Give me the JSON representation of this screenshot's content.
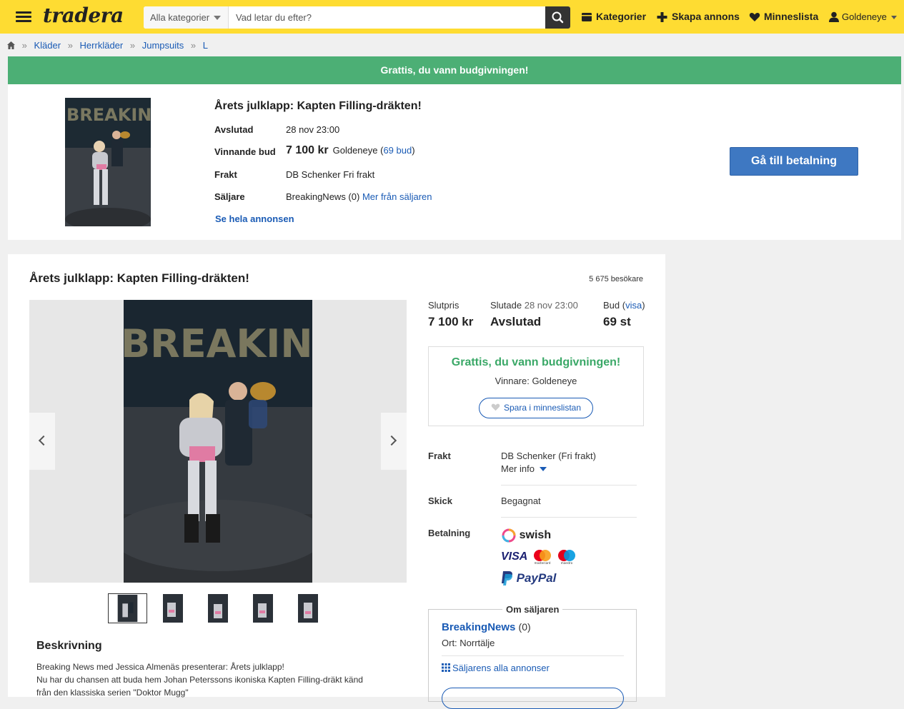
{
  "header": {
    "logo": "tradera",
    "category_select": "Alla kategorier",
    "search_placeholder": "Vad letar du efter?",
    "nav": {
      "kategorier": "Kategorier",
      "skapa": "Skapa annons",
      "minneslista": "Minneslista",
      "user": "Goldeneye"
    }
  },
  "breadcrumb": [
    "Kläder",
    "Herrkläder",
    "Jumpsuits",
    "L"
  ],
  "win_panel": {
    "banner": "Grattis, du vann budgivningen!",
    "title": "Årets julklapp: Kapten Filling-dräkten!",
    "avslutad_label": "Avslutad",
    "avslutad_value": "28 nov 23:00",
    "bid_label": "Vinnande bud",
    "bid_price": "7 100 kr",
    "bid_user": "Goldeneye",
    "bid_count": "69 bud",
    "frakt_label": "Frakt",
    "frakt_value": "DB Schenker Fri frakt",
    "seller_label": "Säljare",
    "seller_value": "BreakingNews (0)",
    "seller_more": "Mer från säljaren",
    "see_full": "Se hela annonsen",
    "pay_button": "Gå till betalning"
  },
  "listing": {
    "title": "Årets julklapp: Kapten Filling-dräkten!",
    "visitors": "5 675 besökare",
    "stats": {
      "slutpris_label": "Slutpris",
      "slutpris_value": "7 100 kr",
      "slutade_label": "Slutade",
      "slutade_date": "28 nov 23:00",
      "slutade_value": "Avslutad",
      "bud_label": "Bud",
      "bud_link": "visa",
      "bud_value": "69 st"
    },
    "won_box": {
      "heading": "Grattis, du vann budgivningen!",
      "winner": "Vinnare: Goldeneye",
      "save_button": "Spara i minneslistan"
    },
    "details": {
      "frakt_label": "Frakt",
      "frakt_value": "DB Schenker (Fri frakt)",
      "frakt_more": "Mer info",
      "skick_label": "Skick",
      "skick_value": "Begagnat",
      "betalning_label": "Betalning",
      "payment_methods": [
        "swish",
        "VISA",
        "mastercard",
        "maestro",
        "PayPal"
      ]
    },
    "seller": {
      "legend": "Om säljaren",
      "name": "BreakingNews",
      "rating": "(0)",
      "location": "Ort: Norrtälje",
      "all_ads": "Säljarens alla annonser"
    },
    "description_heading": "Beskrivning",
    "description_lines": [
      "Breaking News med Jessica Almenäs presenterar: Årets julklapp!",
      "Nu har du chansen att buda hem Johan Peterssons ikoniska Kapten Filling-dräkt känd",
      "från den klassiska serien \"Doktor Mugg\""
    ]
  },
  "colors": {
    "header_yellow": "#fedc32",
    "win_green": "#4caf75",
    "link_blue": "#1a5bb5",
    "pay_button": "#3e78c2"
  }
}
